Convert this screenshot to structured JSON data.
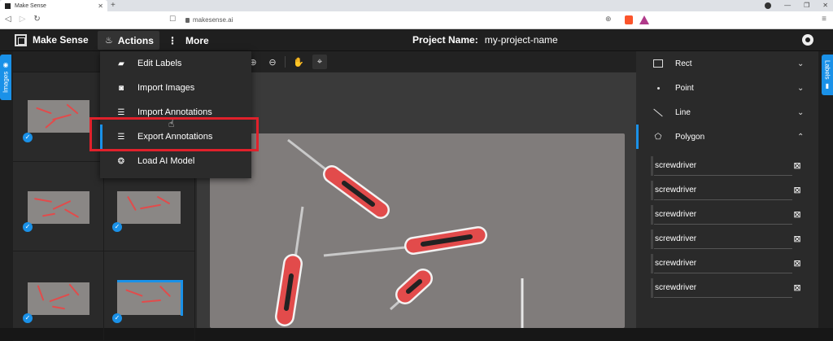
{
  "browser": {
    "tab_title": "Make Sense",
    "url": "makesense.ai"
  },
  "appbar": {
    "brand": "Make Sense",
    "actions_label": "Actions",
    "more_label": "More",
    "project_key": "Project Name:",
    "project_value": "my-project-name"
  },
  "left_tab": {
    "label": "Images"
  },
  "right_tab": {
    "label": "Labels"
  },
  "dropdown": {
    "items": [
      {
        "label": "Edit Labels",
        "icon": "label-icon"
      },
      {
        "label": "Import Images",
        "icon": "camera-icon"
      },
      {
        "label": "Import Annotations",
        "icon": "import-annotations-icon"
      },
      {
        "label": "Export Annotations",
        "icon": "export-annotations-icon"
      },
      {
        "label": "Load AI Model",
        "icon": "brain-icon"
      }
    ],
    "active_index": 3
  },
  "label_types": [
    {
      "label": "Rect",
      "icon": "rect-icon"
    },
    {
      "label": "Point",
      "icon": "point-icon"
    },
    {
      "label": "Line",
      "icon": "line-icon"
    },
    {
      "label": "Polygon",
      "icon": "polygon-icon"
    }
  ],
  "active_label_type": "Polygon",
  "labels": [
    {
      "name": "screwdriver"
    },
    {
      "name": "screwdriver"
    },
    {
      "name": "screwdriver"
    },
    {
      "name": "screwdriver"
    },
    {
      "name": "screwdriver"
    },
    {
      "name": "screwdriver"
    }
  ],
  "colors": {
    "accent": "#1a91e8",
    "highlight": "#e0212b",
    "handle": "#e24b4b"
  }
}
